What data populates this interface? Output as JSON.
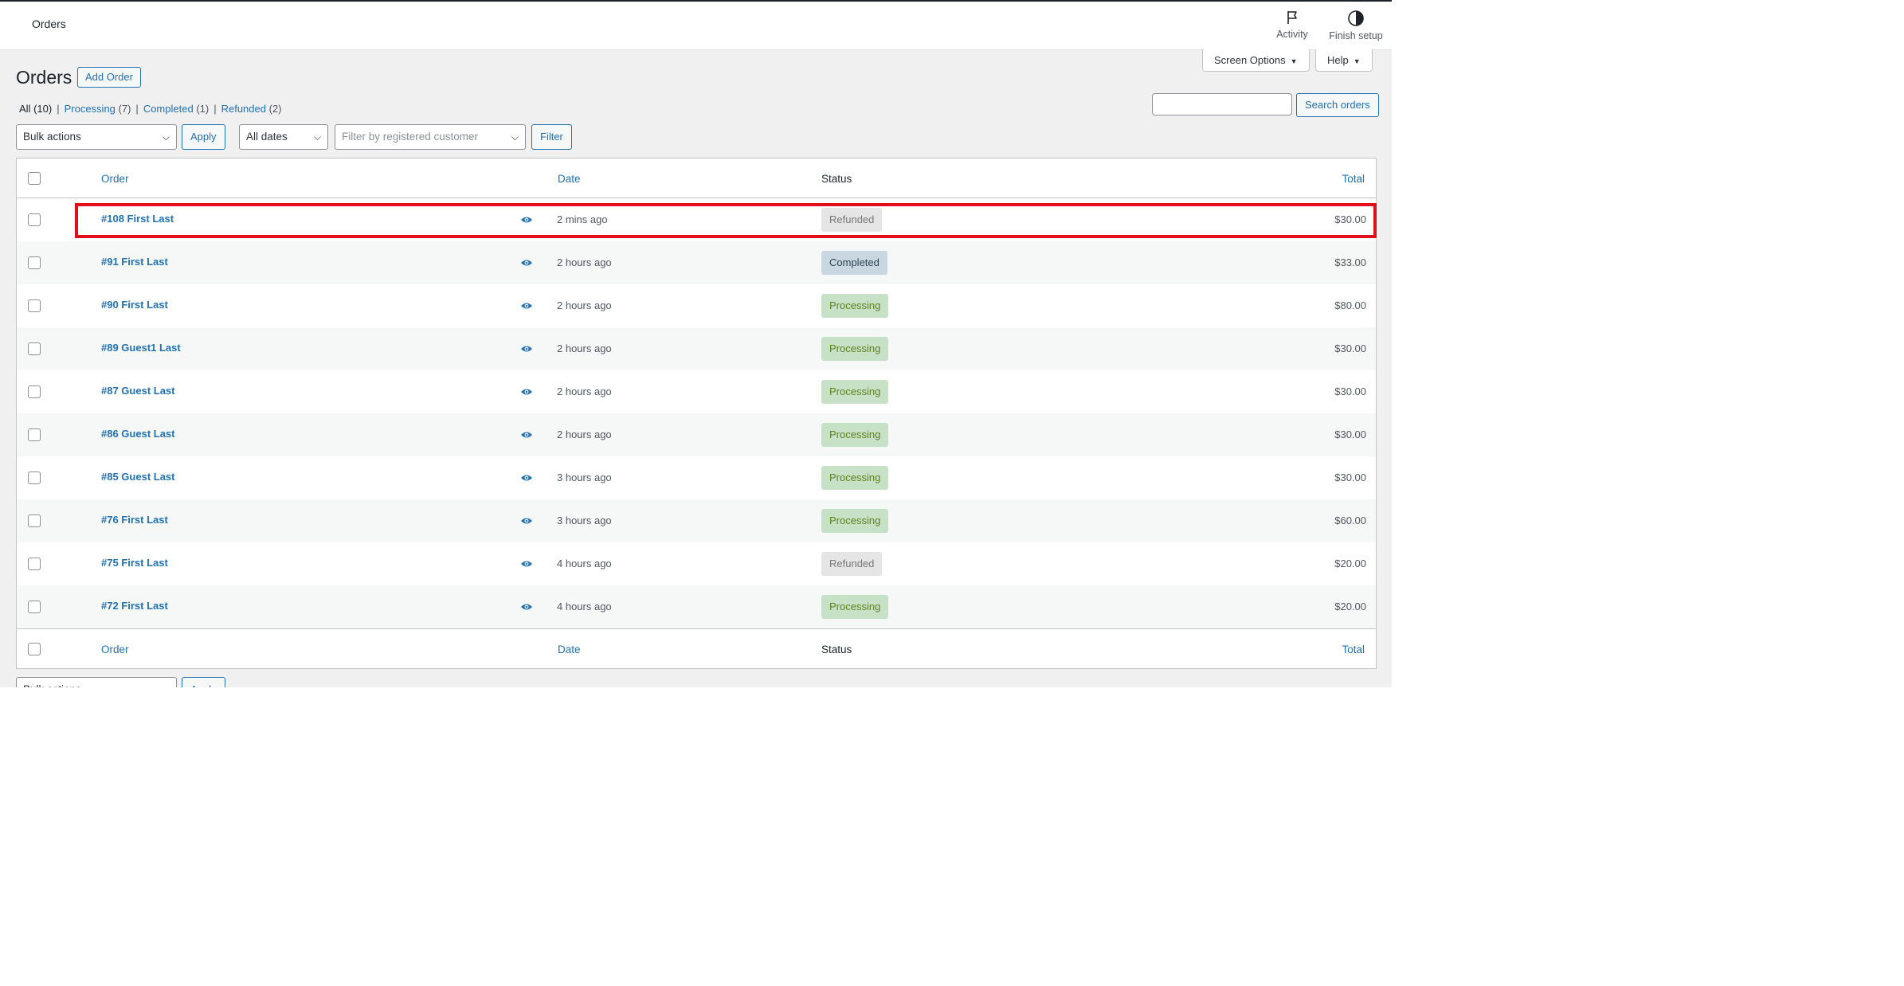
{
  "topbar": {
    "title": "Orders",
    "activity_label": "Activity",
    "finish_setup_label": "Finish setup"
  },
  "screen_options": {
    "label": "Screen Options",
    "help_label": "Help"
  },
  "page": {
    "title": "Orders",
    "add_order_label": "Add Order"
  },
  "filters_views": {
    "all": "All",
    "all_count": "(10)",
    "processing": "Processing",
    "processing_count": "(7)",
    "completed": "Completed",
    "completed_count": "(1)",
    "refunded": "Refunded",
    "refunded_count": "(2)"
  },
  "search": {
    "button_label": "Search orders",
    "value": ""
  },
  "toolbar": {
    "bulk_actions": "Bulk actions",
    "apply_label": "Apply",
    "dates": "All dates",
    "customer_placeholder": "Filter by registered customer",
    "filter_label": "Filter"
  },
  "table": {
    "columns": {
      "order": "Order",
      "date": "Date",
      "status": "Status",
      "total": "Total"
    },
    "rows": [
      {
        "order": "#108 First Last",
        "date": "2 mins ago",
        "status": "Refunded",
        "status_key": "refunded",
        "total": "$30.00"
      },
      {
        "order": "#91 First Last",
        "date": "2 hours ago",
        "status": "Completed",
        "status_key": "completed",
        "total": "$33.00"
      },
      {
        "order": "#90 First Last",
        "date": "2 hours ago",
        "status": "Processing",
        "status_key": "processing",
        "total": "$80.00"
      },
      {
        "order": "#89 Guest1 Last",
        "date": "2 hours ago",
        "status": "Processing",
        "status_key": "processing",
        "total": "$30.00"
      },
      {
        "order": "#87 Guest Last",
        "date": "2 hours ago",
        "status": "Processing",
        "status_key": "processing",
        "total": "$30.00"
      },
      {
        "order": "#86 Guest Last",
        "date": "2 hours ago",
        "status": "Processing",
        "status_key": "processing",
        "total": "$30.00"
      },
      {
        "order": "#85 Guest Last",
        "date": "3 hours ago",
        "status": "Processing",
        "status_key": "processing",
        "total": "$30.00"
      },
      {
        "order": "#76 First Last",
        "date": "3 hours ago",
        "status": "Processing",
        "status_key": "processing",
        "total": "$60.00"
      },
      {
        "order": "#75 First Last",
        "date": "4 hours ago",
        "status": "Refunded",
        "status_key": "refunded",
        "total": "$20.00"
      },
      {
        "order": "#72 First Last",
        "date": "4 hours ago",
        "status": "Processing",
        "status_key": "processing",
        "total": "$20.00"
      }
    ]
  },
  "colors": {
    "accent": "#2271b1",
    "highlight": "#e0101b"
  },
  "icons": {
    "activity": "flag-icon",
    "finish_setup": "half-circle-icon",
    "preview": "eye-icon"
  }
}
